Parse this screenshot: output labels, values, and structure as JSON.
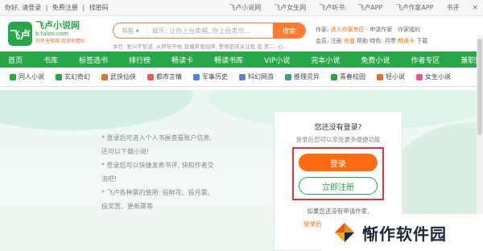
{
  "topbar": {
    "greeting": "你好, 请登录",
    "free_register": "免费注册",
    "retrieve_password": "找密码",
    "links": [
      "飞卢小说网",
      "飞卢女生网",
      "飞卢听书",
      "飞卢APP",
      "飞卢作家APP",
      "书评"
    ],
    "close": "×"
  },
  "logo": {
    "mark": "飞卢",
    "name": "飞卢小说网",
    "domain": "b.faloo.com",
    "slogan": "创作无极限 阅读有精彩"
  },
  "search": {
    "category": "书名 ▾",
    "placeholder": "娱乐: 让你上台卖唱, 你上台卖乐...",
    "button": "搜索",
    "hot": "本社: 复兴宇智波, 从砖窑开始  直播爽鬼玩牌, 警察都叔关注我  我 第二: 心..."
  },
  "header_right": {
    "line1_label": "作家: ",
    "line1_a": "进入作家专区",
    "line1_b": " · 申请作家 · 作家福利",
    "line2_label": "会员: 注册 ",
    "line2_a": "充值",
    "line2_b": " 帮助 特色: 月票 ",
    "line2_c": "畅读卡",
    "line2_d": " 下载"
  },
  "nav": {
    "items": [
      "首页",
      "书库",
      "标签选书",
      "排行榜",
      "畅读卡",
      "畅读书库",
      "VIP小说",
      "完本小说",
      "免费小说",
      "作者专区",
      "兼职赚钱"
    ]
  },
  "subnav": {
    "items": [
      {
        "label": "同人小说",
        "color": "#2aa64a"
      },
      {
        "label": "玄幻奇幻",
        "color": "#2aa64a"
      },
      {
        "label": "武侠仙侠",
        "color": "#e0713a"
      },
      {
        "label": "都市言情",
        "color": "#e35a5a"
      },
      {
        "label": "军事历史",
        "color": "#4b8ad6"
      },
      {
        "label": "科幻网游",
        "color": "#6c7ad8"
      },
      {
        "label": "推理灵异",
        "color": "#3e9e8e"
      },
      {
        "label": "青春校园",
        "color": "#2aa64a"
      },
      {
        "label": "轻小说",
        "color": "#e0713a"
      },
      {
        "label": "女生小说",
        "color": "#e35a9a"
      }
    ]
  },
  "info": {
    "lines": [
      "* 登录后可进入个人书屋查看账户信息,",
      "还可以下载小说!",
      "* 登录后可以快捷发表书评, 快和作者交",
      "流吧!",
      "* 飞卢各种票的使用: 投鲜花、投月票、",
      "投奖赏、更新票等"
    ]
  },
  "card": {
    "title": "您还没有登录?",
    "desc": "登录后您可以享受更多便捷功能",
    "login": "登录",
    "register": "立即注册",
    "apply_text": "如果您还没有申请作家,",
    "apply_link": "登录后..."
  },
  "watermark": {
    "text": "惭作软件园"
  },
  "colors": {
    "brand_green": "#2aa64a",
    "accent_orange": "#ff6a13",
    "highlight_red": "#e53333"
  }
}
